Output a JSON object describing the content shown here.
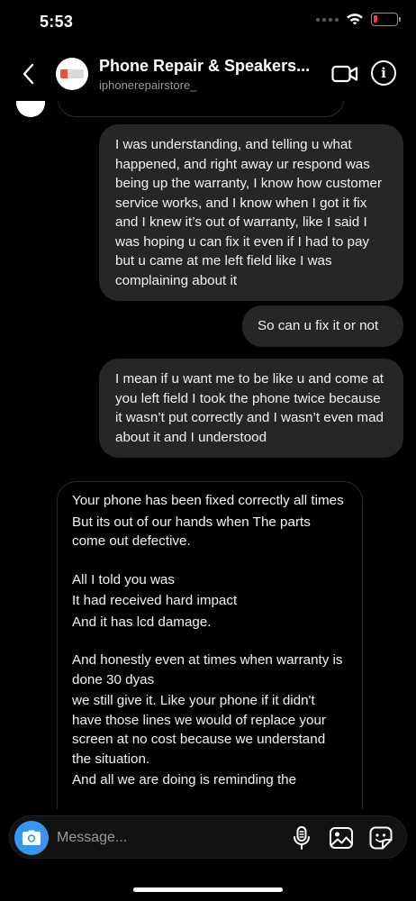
{
  "status_bar": {
    "time": "5:53",
    "battery_level": 0.15,
    "battery_color": "#ff3b30"
  },
  "header": {
    "title": "Phone Repair & Speakers...",
    "username": "iphonerepairstore_",
    "icons": [
      "back-chevron-icon",
      "video-call-icon",
      "info-icon"
    ]
  },
  "messages": [
    {
      "sender": "me",
      "text": "I was understanding, and telling u what happened, and right away ur respond was being up the warranty, I know how customer service works,  and I know when I got it fix and I knew it’s out of warranty, like I said I was hoping u can fix it even if I had to pay but u came at me left field like I was complaining about it"
    },
    {
      "sender": "me",
      "text": "So can u fix it or not"
    },
    {
      "sender": "me",
      "text": "I mean if u want me to be like u and come at you left field I took the phone twice because it wasn’t put correctly and I wasn’t even mad about it and I understood"
    },
    {
      "sender": "them",
      "lines": [
        "Your phone has been fixed correctly all times",
        "But its out of our hands when The parts come out defective.",
        "",
        "All I told you was",
        "It had received hard impact",
        "And it has lcd damage.",
        "",
        "And honestly even at times when warranty is done 30 dyas",
        "we still give it. Like your phone if it didn't have those lines we would of replace your screen at no cost because we understand the situation.",
        "And all we are doing is reminding the"
      ]
    }
  ],
  "composer": {
    "placeholder": "Message...",
    "accent_color": "#3797f0",
    "icons": [
      "camera-icon",
      "microphone-icon",
      "gallery-icon",
      "sticker-icon"
    ]
  }
}
